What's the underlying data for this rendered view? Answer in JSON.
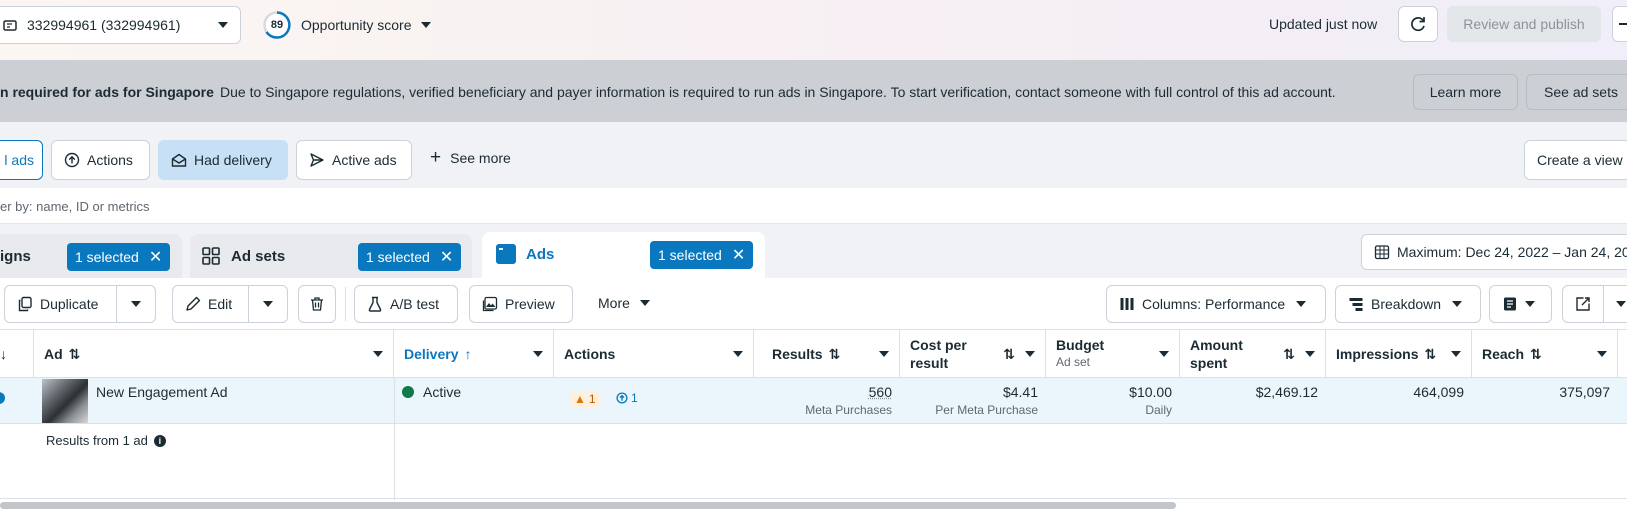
{
  "header": {
    "account": "332994961 (332994961)",
    "score_value": "89",
    "score_label": "Opportunity score",
    "updated": "Updated just now",
    "review_publish": "Review and publish"
  },
  "banner": {
    "title": "n required for ads for Singapore",
    "text": "Due to Singapore regulations, verified beneficiary and payer information is required to run ads in Singapore. To start verification, contact someone with full control of this ad account.",
    "learn_more": "Learn more",
    "see_ad_sets": "See ad sets"
  },
  "filters": {
    "all_ads": "l ads",
    "actions": "Actions",
    "had_delivery": "Had delivery",
    "active_ads": "Active ads",
    "see_more": "See more",
    "create_view": "Create a view"
  },
  "search": {
    "placeholder": "er by: name, ID or metrics"
  },
  "tabs": {
    "campaigns": "igns",
    "campaigns_selected": "1 selected",
    "adsets": "Ad sets",
    "adsets_selected": "1 selected",
    "ads": "Ads",
    "ads_selected": "1 selected"
  },
  "date_range": "Maximum: Dec 24, 2022 – Jan 24, 20",
  "toolbar": {
    "duplicate": "Duplicate",
    "edit": "Edit",
    "ab_test": "A/B test",
    "preview": "Preview",
    "more": "More",
    "columns": "Columns: Performance",
    "breakdown": "Breakdown"
  },
  "table": {
    "headers": {
      "ad": "Ad",
      "delivery": "Delivery",
      "actions": "Actions",
      "results": "Results",
      "cost_per_result": "Cost per result",
      "budget": "Budget",
      "budget_sub": "Ad set",
      "amount_spent": "Amount spent",
      "impressions": "Impressions",
      "reach": "Reach"
    },
    "row": {
      "ad_name": "New Engagement Ad",
      "delivery": "Active",
      "warnings": "1",
      "actions_count": "1",
      "results": "560",
      "results_sub": "Meta Purchases",
      "cost": "$4.41",
      "cost_sub": "Per Meta Purchase",
      "budget": "$10.00",
      "budget_sub": "Daily",
      "spent": "$2,469.12",
      "impressions": "464,099",
      "reach": "375,097"
    },
    "summary": "Results from 1 ad"
  },
  "colors": {
    "accent": "#0a78be",
    "active_dot": "#127a4a",
    "warning": "#e07700"
  }
}
